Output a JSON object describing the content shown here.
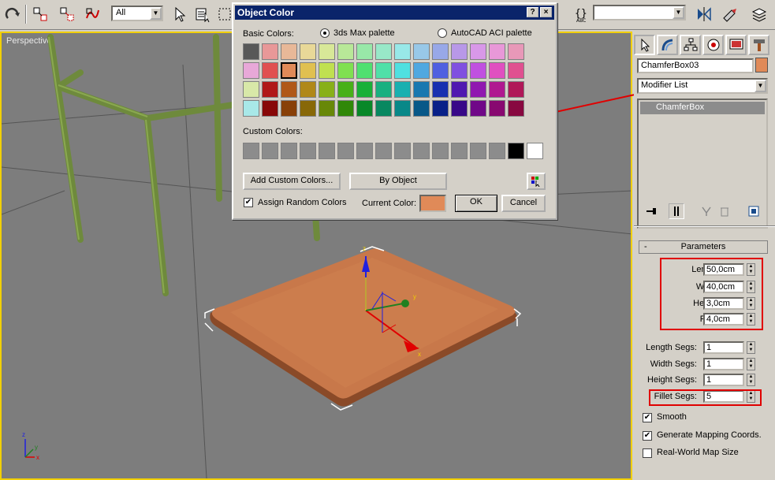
{
  "toolbar": {
    "selection_filter": "All",
    "named_selection": ""
  },
  "viewport": {
    "label": "Perspective",
    "gizmo": {
      "x": "x",
      "y": "y",
      "z": "z"
    },
    "axis_tripod": {
      "x": "x",
      "y": "y",
      "z": "z"
    }
  },
  "dialog": {
    "title": "Object Color",
    "help_button": "?",
    "close_button": "×",
    "basic_colors_label": "Basic Colors:",
    "palette_options": [
      {
        "label": "3ds Max palette",
        "selected": true
      },
      {
        "label": "AutoCAD ACI palette",
        "selected": false
      }
    ],
    "basic_colors": [
      [
        "#585858",
        "#e89898",
        "#e8b898",
        "#e8d898",
        "#d8e898",
        "#b8e898",
        "#98e8a8",
        "#98e8c8",
        "#98e8e8",
        "#98c8e8",
        "#98a8e8",
        "#b898e8",
        "#d898e8",
        "#e898d8",
        "#e898b8"
      ],
      [
        "#e8a8d8",
        "#e05050",
        "#e08a58",
        "#e0c050",
        "#c0e050",
        "#80e050",
        "#50e070",
        "#50e0a8",
        "#50e0e0",
        "#50a8e0",
        "#5060e0",
        "#8050e0",
        "#c050e0",
        "#e050c0",
        "#e05090"
      ],
      [
        "#d8e8a8",
        "#b01818",
        "#b05818",
        "#b08818",
        "#88b018",
        "#48b018",
        "#18b038",
        "#18b080",
        "#18b0b0",
        "#1878b0",
        "#1830b0",
        "#5018b0",
        "#9018b0",
        "#b01890",
        "#b01858"
      ],
      [
        "#a8e8e8",
        "#880808",
        "#884008",
        "#886808",
        "#688808",
        "#308808",
        "#088828",
        "#088860",
        "#088888",
        "#085888",
        "#082088",
        "#380888",
        "#700888",
        "#880870",
        "#880840"
      ]
    ],
    "selected_basic": [
      1,
      2
    ],
    "custom_colors_label": "Custom Colors:",
    "custom_colors": [
      "#8c8c8c",
      "#8c8c8c",
      "#8c8c8c",
      "#8c8c8c",
      "#8c8c8c",
      "#8c8c8c",
      "#8c8c8c",
      "#8c8c8c",
      "#8c8c8c",
      "#8c8c8c",
      "#8c8c8c",
      "#8c8c8c",
      "#8c8c8c",
      "#8c8c8c",
      "#000000",
      "#ffffff"
    ],
    "add_custom_colors": "Add Custom Colors...",
    "by_object": "By Object",
    "assign_random_colors": "Assign Random Colors",
    "assign_random_checked": true,
    "current_color_label": "Current Color:",
    "current_color": "#e08a58",
    "ok": "OK",
    "cancel": "Cancel"
  },
  "command_panel": {
    "object_name": "ChamferBox03",
    "object_color": "#e08a58",
    "modifier_list": "Modifier List",
    "stack_item": "ChamferBox",
    "rollout_toggle": "-",
    "rollout_title": "Parameters",
    "params": [
      {
        "label": "Length:",
        "value": "50,0cm"
      },
      {
        "label": "Width:",
        "value": "40,0cm"
      },
      {
        "label": "Height:",
        "value": "3,0cm"
      },
      {
        "label": "Fillet:",
        "value": "4,0cm"
      }
    ],
    "segs": [
      {
        "label": "Length Segs:",
        "value": "1"
      },
      {
        "label": "Width Segs:",
        "value": "1"
      },
      {
        "label": "Height Segs:",
        "value": "1"
      },
      {
        "label": "Fillet Segs:",
        "value": "5"
      }
    ],
    "checks": [
      {
        "label": "Smooth",
        "checked": true
      },
      {
        "label": "Generate Mapping Coords.",
        "checked": true
      },
      {
        "label": "Real-World Map Size",
        "checked": false
      }
    ]
  },
  "colors": {
    "viewport_bg": "#7d7d7d",
    "active_border": "#f2d000",
    "annotation_red": "#e00000",
    "box_orange": "#c8784a",
    "frame_green": "#6e8a3c"
  }
}
